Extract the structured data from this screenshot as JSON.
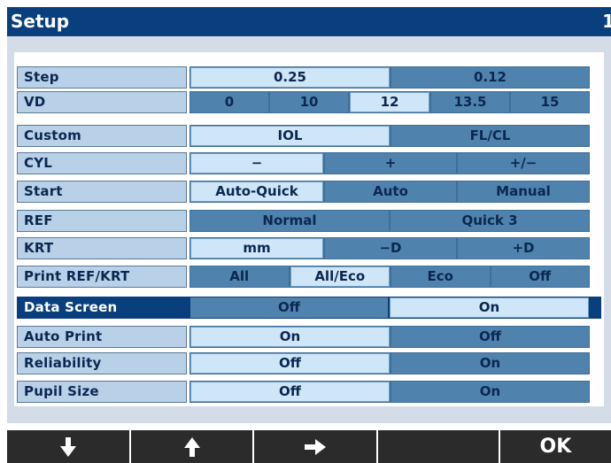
{
  "window": {
    "title": "Setup",
    "page_number": "1"
  },
  "rows": [
    {
      "label": "Step",
      "options": [
        "0.25",
        "0.12"
      ],
      "selected": 0
    },
    {
      "label": "VD",
      "options": [
        "0",
        "10",
        "12",
        "13.5",
        "15"
      ],
      "selected": 2
    },
    {
      "label": "Custom",
      "options": [
        "IOL",
        "FL/CL"
      ],
      "selected": 0
    },
    {
      "label": "CYL",
      "options": [
        "−",
        "+",
        "+/−"
      ],
      "selected": 0
    },
    {
      "label": "Start",
      "options": [
        "Auto-Quick",
        "Auto",
        "Manual"
      ],
      "selected": 0
    },
    {
      "label": "REF",
      "options": [
        "Normal",
        "Quick    3"
      ],
      "selected": -1
    },
    {
      "label": "KRT",
      "options": [
        "mm",
        "−D",
        "+D"
      ],
      "selected": 0
    },
    {
      "label": "Print REF/KRT",
      "options": [
        "All",
        "All/Eco",
        "Eco",
        "Off"
      ],
      "selected": 1
    },
    {
      "label": "Data Screen",
      "options": [
        "Off",
        "On"
      ],
      "selected": 1,
      "active": true
    },
    {
      "label": "Auto Print",
      "options": [
        "On",
        "Off"
      ],
      "selected": 0
    },
    {
      "label": "Reliability",
      "options": [
        "Off",
        "On"
      ],
      "selected": 0
    },
    {
      "label": "Pupil Size",
      "options": [
        "Off",
        "On"
      ],
      "selected": 0
    }
  ],
  "bottom_buttons": [
    {
      "icon": "arrow-down-icon"
    },
    {
      "icon": "arrow-up-icon"
    },
    {
      "icon": "arrow-right-icon"
    },
    {
      "icon": "blank"
    },
    {
      "label": "OK"
    }
  ],
  "colors": {
    "title_bar": "#0a3f7d",
    "panel": "#d4dce8",
    "option_normal": "#4f82ad",
    "option_selected": "#cfe6f8",
    "label_background": "#b8d0e8",
    "bottom_bar": "#2b2b2b"
  }
}
